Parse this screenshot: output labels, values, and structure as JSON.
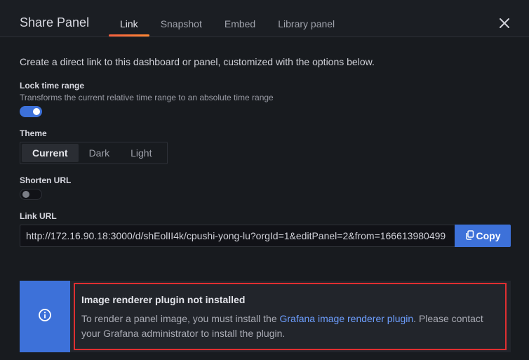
{
  "header": {
    "title": "Share Panel",
    "tabs": [
      {
        "label": "Link",
        "active": true
      },
      {
        "label": "Snapshot",
        "active": false
      },
      {
        "label": "Embed",
        "active": false
      },
      {
        "label": "Library panel",
        "active": false
      }
    ],
    "close_icon": "close-icon"
  },
  "link": {
    "description": "Create a direct link to this dashboard or panel, customized with the options below.",
    "lock_time": {
      "label": "Lock time range",
      "description": "Transforms the current relative time range to an absolute time range",
      "enabled": true
    },
    "theme": {
      "label": "Theme",
      "options": [
        "Current",
        "Dark",
        "Light"
      ],
      "selected": "Current"
    },
    "shorten_url": {
      "label": "Shorten URL",
      "enabled": false
    },
    "link_url": {
      "label": "Link URL",
      "value": "http://172.16.90.18:3000/d/shEolII4k/cpushi-yong-lu?orgId=1&editPanel=2&from=166613980499",
      "copy_label": "Copy",
      "copy_icon": "copy-icon"
    }
  },
  "alert": {
    "icon": "info-icon",
    "title": "Image renderer plugin not installed",
    "body_before": "To render a panel image, you must install the ",
    "link_text": "Grafana image renderer plugin",
    "body_after": ". Please contact your Grafana administrator to install the plugin."
  },
  "colors": {
    "primary": "#3d71d9",
    "accent_gradient_start": "#f55f3e",
    "accent_gradient_end": "#ff8833",
    "highlight_border": "#e02f31",
    "link": "#6e9fff"
  }
}
